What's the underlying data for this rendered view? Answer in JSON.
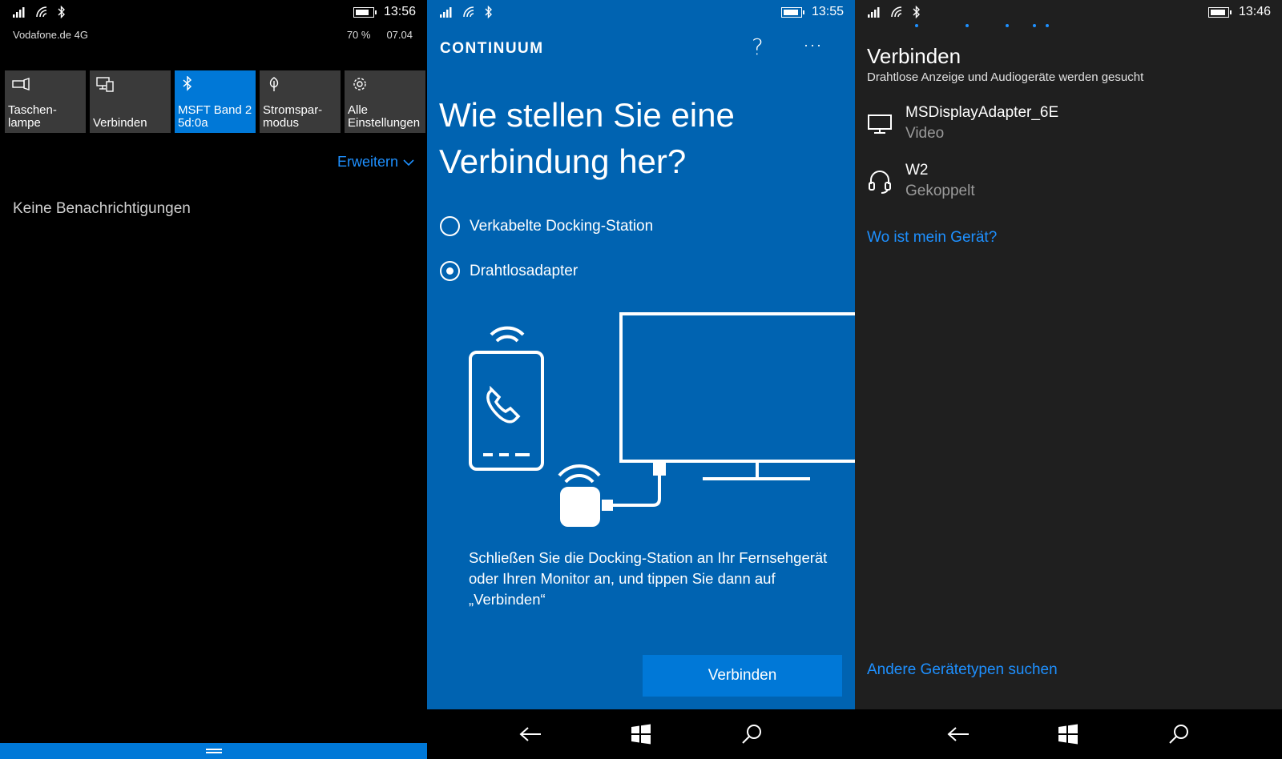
{
  "panel1": {
    "status": {
      "time": "13:56",
      "battery_percent": 70
    },
    "carrier": "Vodafone.de 4G",
    "battery_text": "70 %",
    "date": "07.04",
    "tiles": [
      {
        "label": "Taschen-\nlampe",
        "icon": "flashlight-icon",
        "active": false
      },
      {
        "label": "Verbinden",
        "icon": "connect-icon",
        "active": false
      },
      {
        "label": "MSFT Band 2\n5d:0a",
        "icon": "bluetooth-icon",
        "active": true
      },
      {
        "label": "Stromspar-\nmodus",
        "icon": "battery-saver-icon",
        "active": false
      },
      {
        "label": "Alle\nEinstellungen",
        "icon": "gear-icon",
        "active": false
      }
    ],
    "expand_label": "Erweitern",
    "no_notifications": "Keine Benachrichtigungen"
  },
  "panel2": {
    "status": {
      "time": "13:55",
      "battery_percent": 80
    },
    "app_title": "CONTINUUM",
    "help_label": "?",
    "more_label": "···",
    "question": "Wie stellen Sie eine Verbindung her?",
    "options": [
      {
        "label": "Verkabelte Docking-Station",
        "selected": false
      },
      {
        "label": "Drahtlosadapter",
        "selected": true
      }
    ],
    "description": "Schließen Sie die Docking-Station an Ihr Fernsehgerät oder Ihren Monitor an, und tippen Sie dann auf „Verbinden“",
    "connect_label": "Verbinden"
  },
  "panel3": {
    "status": {
      "time": "13:46",
      "battery_percent": 80
    },
    "title": "Verbinden",
    "subtitle": "Drahtlose Anzeige und Audiogeräte werden gesucht",
    "devices": [
      {
        "name": "MSDisplayAdapter_6E",
        "status": "Video",
        "icon": "monitor-icon"
      },
      {
        "name": "W2",
        "status": "Gekoppelt",
        "icon": "headset-icon"
      }
    ],
    "where_link": "Wo ist mein Gerät?",
    "other_types_link": "Andere Gerätetypen suchen"
  },
  "colors": {
    "accent": "#0078d7",
    "continuum_bg": "#0063b1",
    "link": "#1e90ff",
    "tile": "#3a3a3a",
    "panel3_bg": "#1f1f1f"
  }
}
